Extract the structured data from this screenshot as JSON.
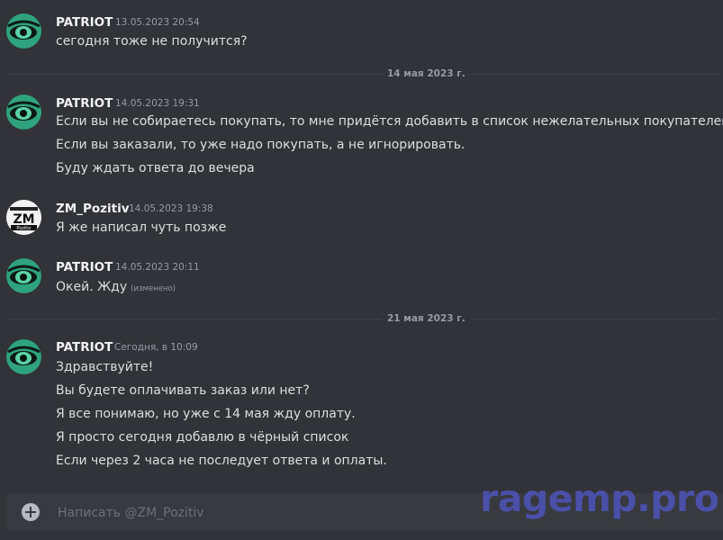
{
  "messages": [
    {
      "author": "PATRIOT",
      "time": "13.05.2023 20:54",
      "lines": [
        "сегодня тоже не получится?"
      ]
    },
    {
      "author": "PATRIOT",
      "time": "14.05.2023 19:31",
      "lines": [
        "Если вы не собираетесь покупать, то мне придётся добавить в список нежелательных покупателей.",
        "Если вы заказали, то уже надо покупать, а не игнорировать.",
        "Буду ждать ответа до вечера"
      ]
    },
    {
      "author": "ZM_Pozitiv",
      "time": "14.05.2023 19:38",
      "lines": [
        "Я же написал чуть позже"
      ]
    },
    {
      "author": "PATRIOT",
      "time": "14.05.2023 20:11",
      "lines": [
        "Окей. Жду"
      ],
      "edited": "(изменено)"
    },
    {
      "author": "PATRIOT",
      "time": "Сегодня, в 10:09",
      "lines": [
        "Здравствуйте!",
        "Вы будете оплачивать заказ или нет?",
        "Я все понимаю, но уже с 14 мая жду оплату.",
        "Я просто сегодня добавлю в чёрный список",
        "Если через 2 часа не последует ответа и оплаты."
      ]
    }
  ],
  "dividers": [
    "14 мая 2023 г.",
    "21 мая 2023 г."
  ],
  "composer": {
    "placeholder": "Написать @ZM_Pozitiv"
  },
  "watermark": "ragemp.pro",
  "avatar2_text": "ZM",
  "avatar2_sub": "Pozitiv",
  "colors": {
    "background": "#313338",
    "composer": "#383a40",
    "watermark": "#4a4fa8",
    "avatar_patriot": "#2fa37e"
  }
}
